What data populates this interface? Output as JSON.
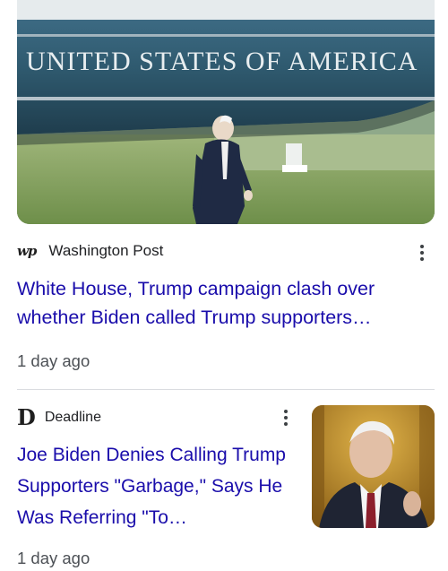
{
  "articles": [
    {
      "image": {
        "banner_text": "UNITED STATES OF AMERICA",
        "description_icon": "photo-icon"
      },
      "source": {
        "logo_text": "wp",
        "name": "Washington Post"
      },
      "headline": "White House, Trump campaign clash over whether Biden called Trump supporters…",
      "time": "1 day ago",
      "more_icon": "more-vert-icon"
    },
    {
      "source": {
        "logo_text": "D",
        "name": "Deadline"
      },
      "headline": "Joe Biden Denies Calling Trump Supporters \"Garbage,\" Says He Was Referring \"To…",
      "time": "1 day ago",
      "more_icon": "more-vert-icon"
    }
  ],
  "colors": {
    "headline_link": "#1a0dab",
    "meta_text": "#4d5156",
    "divider": "#dadce0"
  }
}
